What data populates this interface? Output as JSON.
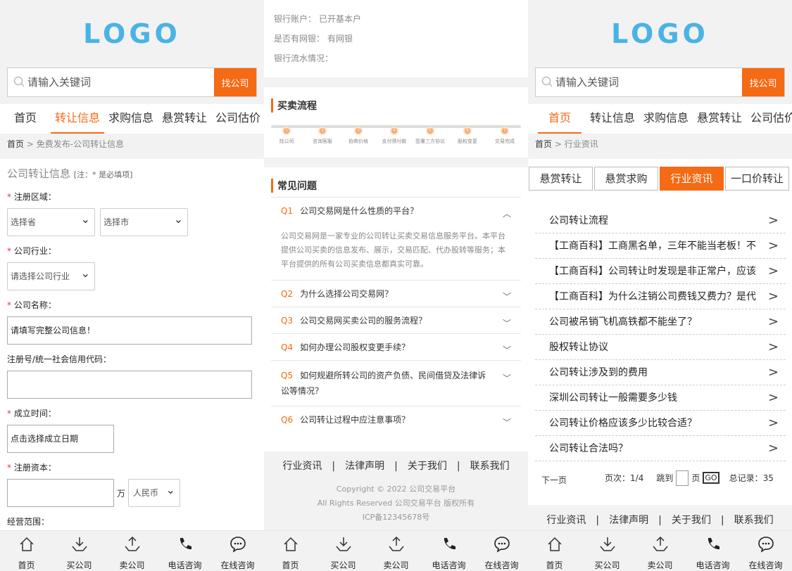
{
  "logo": "LOGO",
  "search": {
    "placeholder": "请输入关键词",
    "button": "找公司"
  },
  "nav": [
    "首页",
    "转让信息",
    "求购信息",
    "悬赏转让",
    "公司估价"
  ],
  "tabbar": [
    "首页",
    "买公司",
    "卖公司",
    "电话咨询",
    "在线咨询"
  ],
  "panel1": {
    "breadcrumb": {
      "home": "首页",
      "sep": ">",
      "current": "免费发布-公司转让信息"
    },
    "form_title": "公司转让信息",
    "form_note": "[注：* 是必填项]",
    "region_label": "注册区域：",
    "province": "选择省",
    "city": "选择市",
    "industry_label": "公司行业：",
    "industry": "请选择公司行业",
    "name_label": "公司名称：",
    "name_value": "请填写完整公司信息！",
    "code_label": "注册号/统一社会信用代码：",
    "date_label": "成立时间：",
    "date_value": "点击选择成立日期",
    "capital_label": "注册资本：",
    "capital_unit": "万",
    "currency": "人民币",
    "scope_label": "经营范围："
  },
  "panel2": {
    "bank": [
      {
        "label": "银行账户：",
        "value": "已开基本户"
      },
      {
        "label": "是否有网银：",
        "value": "有网银"
      },
      {
        "label": "银行流水情况：",
        "value": ""
      }
    ],
    "process_title": "买卖流程",
    "steps": [
      "找公司",
      "咨询客服",
      "协商价格",
      "支付预付款",
      "签署三方协议",
      "股权变更",
      "交易完成"
    ],
    "faq_title": "常见问题",
    "faqs": [
      {
        "q": "Q1",
        "text": "公司交易网是什么性质的平台？",
        "answer": "公司交易网是一家专业的公司转让买卖交易信息服务平台。本平台提供公司买卖的信息发布、展示，交易匹配、代办股转等服务；本平台提供的所有公司买卖信息都真实可靠。"
      },
      {
        "q": "Q2",
        "text": "为什么选择公司交易网？"
      },
      {
        "q": "Q3",
        "text": "公司交易网买卖公司的服务流程？"
      },
      {
        "q": "Q4",
        "text": "如何办理公司股权变更手续？"
      },
      {
        "q": "Q5",
        "text": "如何规避所转公司的资产负债、民间借贷及法律诉讼等情况？"
      },
      {
        "q": "Q6",
        "text": "公司转让过程中应注意事项？"
      }
    ],
    "footer_links": "行业资讯　|　法律声明　|　关于我们　|　联系我们",
    "copyright": [
      "Copyright © 2022 公司交易平台",
      "All Rights Reserved 公司交易平台 版权所有",
      "ICP备12345678号"
    ]
  },
  "panel3": {
    "breadcrumb": {
      "home": "首页",
      "sep": ">",
      "current": "行业资讯"
    },
    "subtabs": [
      "悬赏转让",
      "悬赏求购",
      "行业资讯",
      "一口价转让"
    ],
    "news": [
      "公司转让流程",
      "【工商百科】工商黑名单，三年不能当老板！不",
      "【工商百科】公司转让时发现是非正常户，应该",
      "【工商百科】为什么注销公司费钱又费力？是代",
      "公司被吊销飞机高铁都不能坐了？",
      "股权转让协议",
      "公司转让涉及到的费用",
      "深圳公司转让一般需要多少钱",
      "公司转让价格应该多少比较合适？",
      "公司转让合法吗？"
    ],
    "pager": {
      "next": "下一页",
      "pages": "页次：1/4",
      "jump": "跳到",
      "page": "页",
      "go": "GO",
      "total": "总记录：35"
    },
    "footer_links": "行业资讯　|　法律声明　|　关于我们　|　联系我们"
  }
}
